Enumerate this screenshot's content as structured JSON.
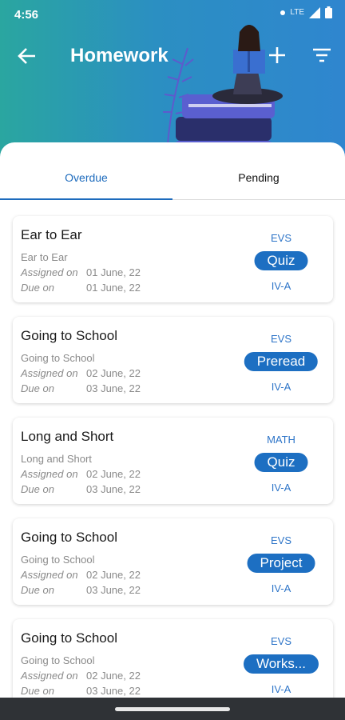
{
  "status_bar": {
    "time": "4:56",
    "network": "LTE"
  },
  "header": {
    "title": "Homework"
  },
  "tabs": [
    {
      "label": "Overdue",
      "selected": true
    },
    {
      "label": "Pending",
      "selected": false
    }
  ],
  "labels": {
    "assigned": "Assigned on",
    "due": "Due on"
  },
  "homework": [
    {
      "title": "Ear to Ear",
      "subtitle": "Ear to Ear",
      "assigned": "01 June, 22",
      "due": "01 June, 22",
      "subject": "EVS",
      "type": "Quiz",
      "class": "IV-A"
    },
    {
      "title": "Going to School",
      "subtitle": "Going to School",
      "assigned": "02 June, 22",
      "due": "03 June, 22",
      "subject": "EVS",
      "type": "Preread",
      "class": "IV-A"
    },
    {
      "title": "Long and Short",
      "subtitle": "Long and Short",
      "assigned": "02 June, 22",
      "due": "03 June, 22",
      "subject": "MATH",
      "type": "Quiz",
      "class": "IV-A"
    },
    {
      "title": "Going to School",
      "subtitle": "Going to School",
      "assigned": "02 June, 22",
      "due": "03 June, 22",
      "subject": "EVS",
      "type": "Project",
      "class": "IV-A"
    },
    {
      "title": "Going to School",
      "subtitle": "Going to School",
      "assigned": "02 June, 22",
      "due": "03 June, 22",
      "subject": "EVS",
      "type": "Works...",
      "class": "IV-A"
    }
  ],
  "colors": {
    "accent": "#1d6fc2",
    "link": "#2e75c8",
    "header_start": "#2aa6a0",
    "header_end": "#2f86cf"
  },
  "icons": {
    "back": "arrow-left-icon",
    "add": "plus-icon",
    "filter": "filter-icon"
  }
}
